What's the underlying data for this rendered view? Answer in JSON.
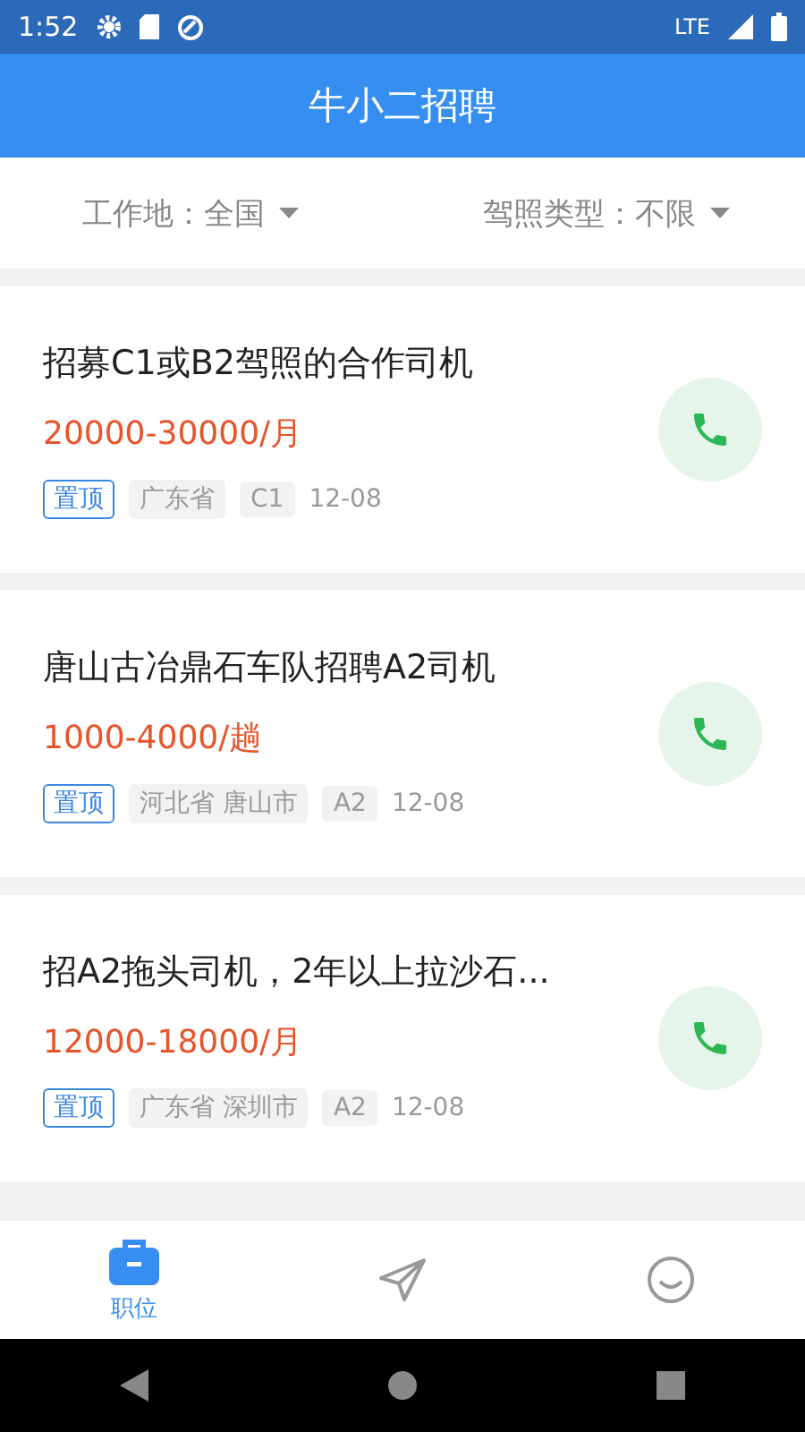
{
  "status_bar": {
    "time": "1:52",
    "network": "LTE"
  },
  "app_bar": {
    "title": "牛小二招聘"
  },
  "filters": [
    {
      "label": "工作地：全国"
    },
    {
      "label": "驾照类型：不限"
    }
  ],
  "jobs": [
    {
      "title": "招募C1或B2驾照的合作司机",
      "salary": "20000-30000/月",
      "pinned_label": "置顶",
      "tags": [
        "广东省",
        "C1"
      ],
      "date": "12-08"
    },
    {
      "title": "唐山古冶鼎石车队招聘A2司机",
      "salary": "1000-4000/趟",
      "pinned_label": "置顶",
      "tags": [
        "河北省 唐山市",
        "A2"
      ],
      "date": "12-08"
    },
    {
      "title": "招A2拖头司机，2年以上拉沙石...",
      "salary": "12000-18000/月",
      "pinned_label": "置顶",
      "tags": [
        "广东省 深圳市",
        "A2"
      ],
      "date": "12-08"
    }
  ],
  "bottom_nav": [
    {
      "kind": "briefcase",
      "label": "职位",
      "selected": true
    },
    {
      "kind": "send",
      "selected": false
    },
    {
      "kind": "smile",
      "selected": false
    }
  ]
}
